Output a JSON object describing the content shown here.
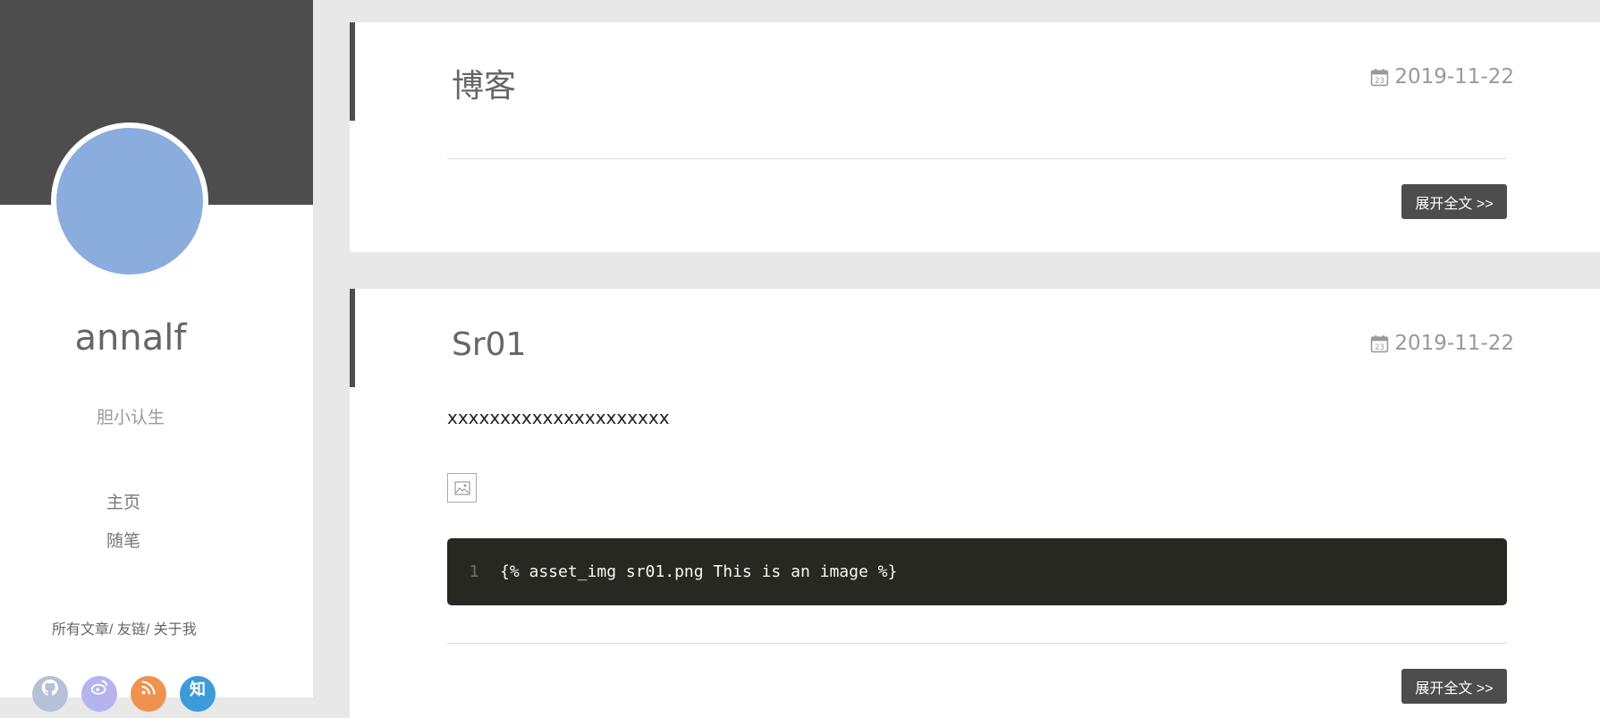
{
  "sidebar": {
    "author_name": "annalf",
    "motto": "胆小认生",
    "nav": [
      {
        "label": "主页"
      },
      {
        "label": "随笔"
      }
    ],
    "sub_links": [
      "所有文章/",
      " 友链/",
      " 关于我"
    ],
    "socials": [
      {
        "icon": "github-icon",
        "color": "#b6c0d6"
      },
      {
        "icon": "weibo-icon",
        "color": "#b5b3f0"
      },
      {
        "icon": "rss-icon",
        "color": "#ef9250"
      },
      {
        "icon": "zhihu-icon",
        "color": "#3d9bd9",
        "glyph": "知"
      }
    ]
  },
  "articles": [
    {
      "title": "博客",
      "date": "2019-11-22",
      "readmore": "展开全文 >>"
    },
    {
      "title": "Sr01",
      "date": "2019-11-22",
      "excerpt": "xxxxxxxxxxxxxxxxxxxxx",
      "code_line_number": "1",
      "code": "{% asset_img sr01.png This is an image %}",
      "readmore": "展开全文 >>"
    }
  ],
  "colors": {
    "banner": "#4d4d4d",
    "avatar": "#8aaddd",
    "page_bg": "#e8e8e8",
    "code_bg": "#272822"
  }
}
